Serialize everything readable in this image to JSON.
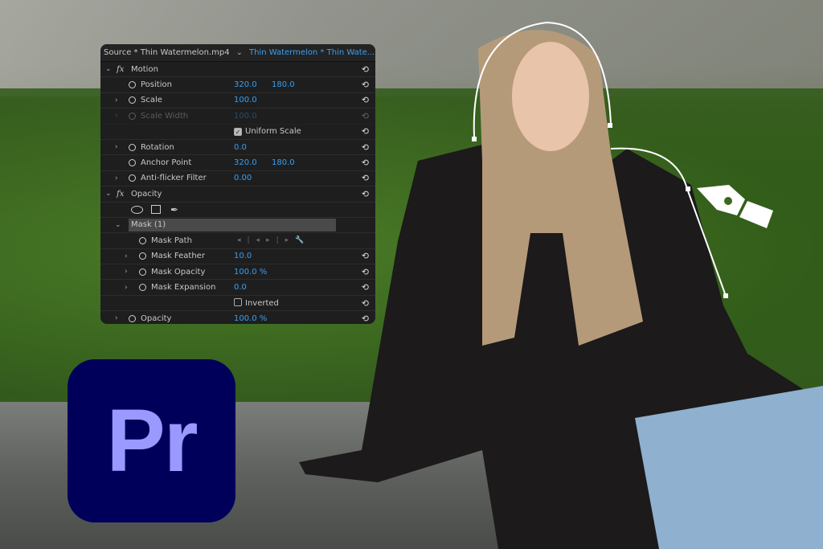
{
  "panel": {
    "tabs": {
      "source": "Source * Thin Watermelon.mp4",
      "sequence": "Thin Watermelon * Thin Wate..."
    },
    "rows": [
      {
        "label": "Motion",
        "fx": true
      },
      {
        "label": "Position",
        "v1": "320.0",
        "v2": "180.0"
      },
      {
        "label": "Scale",
        "v1": "100.0"
      },
      {
        "label": "Scale Width",
        "v1": "100.0"
      },
      {
        "label": "Uniform Scale"
      },
      {
        "label": "Rotation",
        "v1": "0.0"
      },
      {
        "label": "Anchor Point",
        "v1": "320.0",
        "v2": "180.0"
      },
      {
        "label": "Anti-flicker Filter",
        "v1": "0.00"
      },
      {
        "label": "Opacity",
        "fx": true
      },
      {
        "label": "Mask (1)"
      },
      {
        "label": "Mask Path"
      },
      {
        "label": "Mask Feather",
        "v1": "10.0"
      },
      {
        "label": "Mask Opacity",
        "v1": "100.0 %"
      },
      {
        "label": "Mask Expansion",
        "v1": "0.0"
      },
      {
        "label": "Inverted"
      },
      {
        "label": "Opacity",
        "v1": "100.0 %"
      }
    ],
    "fx_glyph": "fx",
    "reset_glyph": "⟲"
  },
  "logo": {
    "text": "Pr",
    "bg": "#00005b",
    "fg": "#9999ff"
  },
  "accent": "#3a9ff0"
}
